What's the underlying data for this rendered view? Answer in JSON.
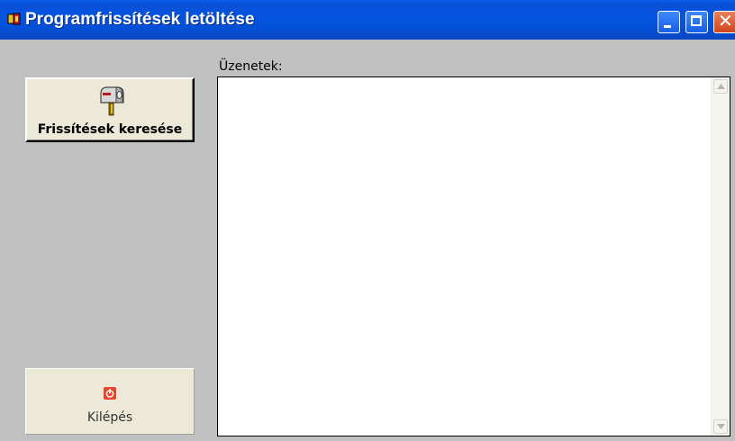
{
  "window": {
    "title": "Programfrissítések letöltése",
    "controls": {
      "minimize": "minimize",
      "maximize": "maximize",
      "close": "close"
    }
  },
  "sidebar": {
    "check_updates_label": "Frissítések keresése",
    "check_updates_icon": "mailbox-icon",
    "exit_label": "Kilépés",
    "exit_icon": "power-icon"
  },
  "messages": {
    "label": "Üzenetek:",
    "content": ""
  },
  "colors": {
    "titlebar": "#0454e0",
    "window_bg": "#c0c0c0",
    "button_bg": "#ece9d8",
    "close_button": "#d0451c"
  }
}
